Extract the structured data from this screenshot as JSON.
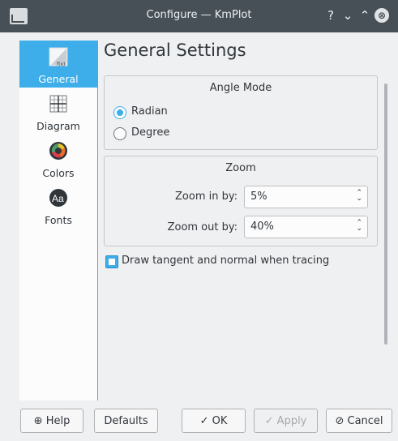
{
  "window": {
    "title": "Configure — KmPlot",
    "controls": [
      "?",
      "⌄",
      "⌃",
      "⊗"
    ]
  },
  "sidebar": {
    "items": [
      {
        "label": "General",
        "icon": "general-icon",
        "active": true
      },
      {
        "label": "Diagram",
        "icon": "diagram-icon"
      },
      {
        "label": "Colors",
        "icon": "colors-icon"
      },
      {
        "label": "Fonts",
        "icon": "fonts-icon"
      }
    ]
  },
  "page": {
    "title": "General Settings"
  },
  "angle_mode": {
    "title": "Angle Mode",
    "options": [
      {
        "label": "Radian",
        "selected": true
      },
      {
        "label": "Degree",
        "selected": false
      }
    ]
  },
  "zoom": {
    "title": "Zoom",
    "zoom_in_label": "Zoom in by:",
    "zoom_in_value": "5%",
    "zoom_out_label": "Zoom out by:",
    "zoom_out_value": "40%"
  },
  "tracing": {
    "label": "Draw tangent and normal when tracing",
    "checked": true
  },
  "buttons": {
    "help": "Help",
    "defaults": "Defaults",
    "ok": "OK",
    "apply": "Apply",
    "cancel": "Cancel"
  },
  "colors": {
    "accent": "#3daee9",
    "titlebar": "#475057",
    "window": "#eff0f1"
  }
}
